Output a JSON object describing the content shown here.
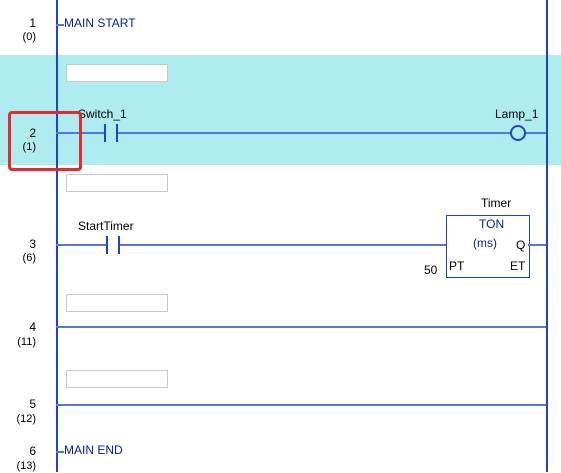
{
  "rungs": [
    {
      "number": "1",
      "step": "(0)",
      "label": "MAIN START"
    },
    {
      "number": "2",
      "step": "(1)",
      "contact": "Switch_1",
      "coil": "Lamp_1"
    },
    {
      "number": "3",
      "step": "(6)",
      "contact": "StartTimer",
      "timer": {
        "instance": "Timer",
        "type": "TON",
        "unit": "(ms)",
        "pt_value": "50",
        "pin_pt": "PT",
        "pin_q": "Q",
        "pin_et": "ET"
      }
    },
    {
      "number": "4",
      "step": "(11)"
    },
    {
      "number": "5",
      "step": "(12)"
    },
    {
      "number": "6",
      "step": "(13)",
      "label": "MAIN END"
    }
  ],
  "comments": [
    "",
    "",
    "",
    "",
    ""
  ],
  "colors": {
    "rail": "#2244cc",
    "highlight": "#aeecef",
    "selection": "#e8282d"
  }
}
